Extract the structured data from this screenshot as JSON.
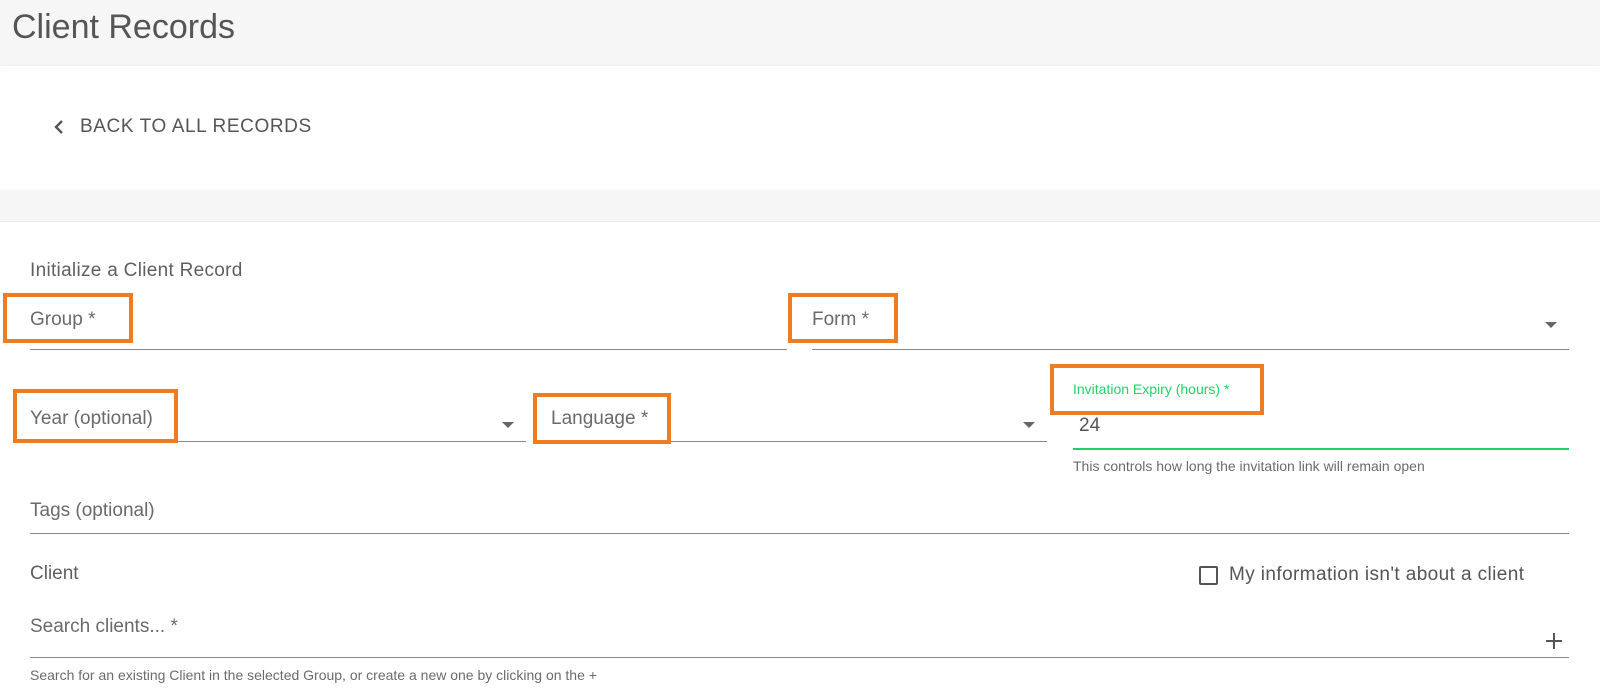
{
  "header": {
    "title": "Client Records"
  },
  "back": {
    "label": "BACK TO ALL RECORDS",
    "icon": "chevron-left-icon"
  },
  "form": {
    "section_title": "Initialize a Client Record",
    "group": {
      "label": "Group *"
    },
    "form_select": {
      "label": "Form *"
    },
    "year": {
      "label": "Year (optional)"
    },
    "language": {
      "label": "Language *"
    },
    "expiry": {
      "label": "Invitation Expiry (hours) *",
      "value": "24",
      "helper": "This controls how long the invitation link will remain open"
    },
    "tags": {
      "label": "Tags (optional)"
    },
    "client": {
      "title": "Client",
      "checkbox_label": "My information isn't about a client",
      "search_label": "Search clients... *",
      "helper": "Search for an existing Client in the selected Group, or create a new one by clicking on the +"
    }
  },
  "colors": {
    "highlight": "#f07c22",
    "focus": "#26d068"
  }
}
